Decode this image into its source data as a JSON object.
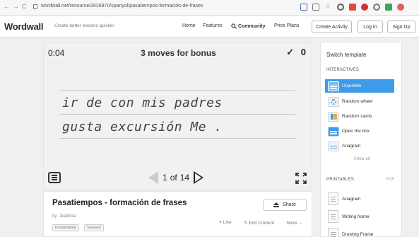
{
  "browser": {
    "url": "wordwall.net/resource/2828970/spanyol/pasatiempos-formación-de-frases",
    "nav": {
      "back": "←",
      "forward": "→",
      "reload": "C"
    },
    "extension_colors": [
      "#4b6fa6",
      "#7a7a7a",
      "#c97c2a",
      "#5d5d5d",
      "#e24c3b",
      "#cc3333",
      "#777777",
      "#3aa757",
      "#e06060"
    ]
  },
  "header": {
    "logo": "Wordwall",
    "tagline": "Create better lessons quicker",
    "nav": [
      "Home",
      "Features",
      "Community",
      "Price Plans"
    ],
    "buttons": {
      "create": "Create Activity",
      "login": "Log In",
      "signup": "Sign Up"
    }
  },
  "game": {
    "timer": "0:04",
    "bonus_text": "3 moves for bonus",
    "score_mark": "✓",
    "score": "0",
    "sentences": [
      "ir de con mis padres",
      "gusta excursión Me ."
    ],
    "pager": {
      "current": "1",
      "of_label": "of",
      "total": "14"
    }
  },
  "info": {
    "title": "Pasatiempos - formación de frases",
    "by_label": "by",
    "author": "Jkattinka",
    "tags": [
      "Középiskola",
      "Spanyol"
    ],
    "share_label": "Share",
    "actions": {
      "like": "Like",
      "edit": "Edit Content",
      "more": "More"
    }
  },
  "sidebar": {
    "heading": "Switch template",
    "interactives_label": "INTERACTIVES",
    "templates": [
      {
        "label": "Unjumble",
        "active": true
      },
      {
        "label": "Random wheel",
        "active": false
      },
      {
        "label": "Random cards",
        "active": false
      },
      {
        "label": "Open the box",
        "active": false
      },
      {
        "label": "Anagram",
        "active": false
      }
    ],
    "show_all": "Show all",
    "printables_label": "PRINTABLES",
    "pdf_label": "PDF",
    "printables": [
      "Anagram",
      "Writing frame",
      "Drawing Frame"
    ],
    "accent_color": "#3d9be9"
  }
}
